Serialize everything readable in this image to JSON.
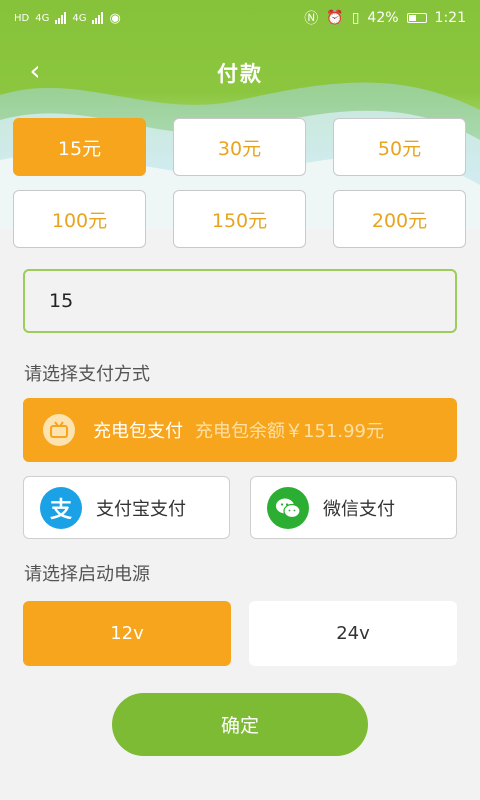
{
  "status_bar": {
    "left_labels": [
      "HD",
      "4G",
      "4G"
    ],
    "battery": "42%",
    "time": "1:21"
  },
  "header": {
    "title": "付款",
    "back_icon": "chevron-left-icon"
  },
  "amounts": [
    {
      "label": "15元",
      "selected": true
    },
    {
      "label": "30元",
      "selected": false
    },
    {
      "label": "50元",
      "selected": false
    },
    {
      "label": "100元",
      "selected": false
    },
    {
      "label": "150元",
      "selected": false
    },
    {
      "label": "200元",
      "selected": false
    }
  ],
  "amount_input": {
    "value": "15"
  },
  "payment_section": {
    "label": "请选择支付方式",
    "wallet": {
      "label": "充电包支付",
      "balance": "充电包余额￥151.99元"
    },
    "alipay": {
      "label": "支付宝支付",
      "glyph": "支"
    },
    "wechat": {
      "label": "微信支付"
    }
  },
  "power_section": {
    "label": "请选择启动电源",
    "options": [
      {
        "label": "12v",
        "selected": true
      },
      {
        "label": "24v",
        "selected": false
      }
    ]
  },
  "confirm_label": "确定",
  "colors": {
    "accent_orange": "#f6a51c",
    "header_green": "#8cc63f",
    "confirm_green": "#7dbb34",
    "alipay_blue": "#1aa1e6",
    "wechat_green": "#2bae32"
  }
}
